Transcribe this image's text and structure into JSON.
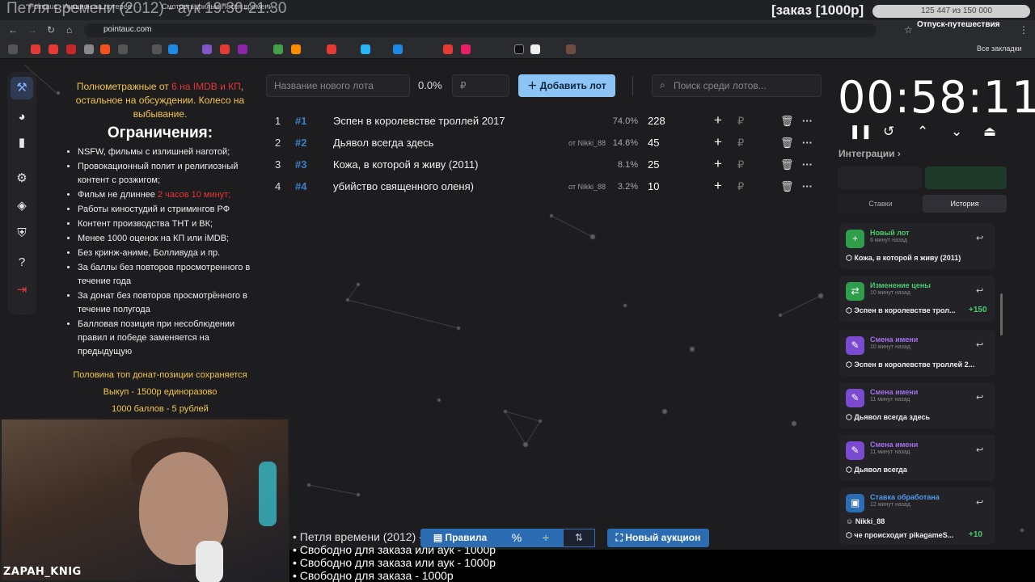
{
  "browser": {
    "tabs": [
      "Pointauc - Аукцион на лотерее",
      "Смотреть фильм Петля времени"
    ],
    "url": "pointauc.com",
    "bookmarks_label": "Все закладки",
    "overlay_title": "Петля времени (2012) - аук 19:30-21:30",
    "order_title": "[заказ [1000р]",
    "progress_text": "125 447 из 150 000",
    "vacation_text": "Отпуск-путешествия"
  },
  "rules": {
    "intro_a": "Полнометражные от ",
    "intro_red": "6 на IMDB и КП",
    "intro_b": ", остальное на обсуждении. Колесо на выбывание.",
    "heading": "Ограничения:",
    "items": [
      "NSFW, фильмы с излишней наготой;",
      "Провокационный полит и религиозный контент с розжигом;",
      "Фильм не длиннее ",
      "Работы киностудий и стримингов РФ",
      "Контент производства ТНТ и ВК;",
      "Менее 1000 оценок на КП или iMDB;",
      "Без кринж-аниме, Болливуда и пр.",
      "За баллы без повторов просмотренного в течение года",
      "За донат без повторов просмотренного в течение полугода",
      "Балловая позиция при несоблюдении правил и победе заменяется на предыдущую"
    ],
    "length_red": "2 часов 10 минут;",
    "foot": [
      "Половина топ донат-позиции сохраняется",
      "Выкуп - 1500р единоразово",
      "1000 баллов - 5 рублей"
    ]
  },
  "toolbar": {
    "new_lot_placeholder": "Название нового лота",
    "percent": "0.0%",
    "currency": "₽",
    "add_label": "Добавить лот",
    "search_placeholder": "Поиск среди лотов..."
  },
  "lots": [
    {
      "n": "1",
      "id": "#1",
      "title": "Эспен в королевстве троллей 2017",
      "from": "",
      "pct": "74.0%",
      "amount": "228"
    },
    {
      "n": "2",
      "id": "#2",
      "title": "Дьявол всегда здесь",
      "from": "от Nikki_88",
      "pct": "14.6%",
      "amount": "45"
    },
    {
      "n": "3",
      "id": "#3",
      "title": "Кожа, в которой я живу (2011)",
      "from": "",
      "pct": "8.1%",
      "amount": "25"
    },
    {
      "n": "4",
      "id": "#4",
      "title": "убийство священного оленя)",
      "from": "от Nikki_88",
      "pct": "3.2%",
      "amount": "10"
    }
  ],
  "timer": "00:58:11",
  "integrations_label": "Интеграции",
  "history_tabs": {
    "bids": "Ставки",
    "history": "История"
  },
  "history": [
    {
      "type": "Новый лот",
      "ago": "6 минут назад",
      "body": "Кожа, в которой я живу (2011)",
      "delta": "",
      "color": "#49cc6e",
      "badge_bg": "#2f9e4a",
      "icon": "+"
    },
    {
      "type": "Изменение цены",
      "ago": "10 минут назад",
      "body": "Эспен в королевстве трол...",
      "delta": "+150",
      "color": "#49cc6e",
      "badge_bg": "#2f9e4a",
      "icon": "⇄"
    },
    {
      "type": "Смена имени",
      "ago": "10 минут назад",
      "body": "Эспен в королевстве троллей 2...",
      "delta": "",
      "color": "#a46ff0",
      "badge_bg": "#7a4ad0",
      "icon": "✎"
    },
    {
      "type": "Смена имени",
      "ago": "11 минут назад",
      "body": "Дьявол всегда здесь",
      "delta": "",
      "color": "#a46ff0",
      "badge_bg": "#7a4ad0",
      "icon": "✎"
    },
    {
      "type": "Смена имени",
      "ago": "11 минут назад",
      "body": "Дьявол всегда",
      "delta": "",
      "color": "#a46ff0",
      "badge_bg": "#7a4ad0",
      "icon": "✎"
    },
    {
      "type": "Ставка обработана",
      "ago": "12 минут назад",
      "body": "Nikki_88",
      "body2": "че происходит pikagameS...",
      "delta": "+10",
      "color": "#4f9bef",
      "badge_bg": "#2b6cb3",
      "icon": "▣"
    }
  ],
  "bottom": {
    "rules_label": "Правила",
    "new_auction": "Новый аукцион"
  },
  "queue": [
    "• Петля времени (2012) - аук",
    "• Свободно для заказа или аук - 1000р",
    "• Свободно для заказа или аук - 1000р",
    "• Свободно для заказа - 1000р"
  ],
  "streamer": "ZAPAH_KNIG",
  "colors": {
    "accent": "#8cc4f5",
    "gold": "#f3c64a",
    "red": "#e53535",
    "green": "#49cc6e",
    "purple": "#a46ff0"
  }
}
